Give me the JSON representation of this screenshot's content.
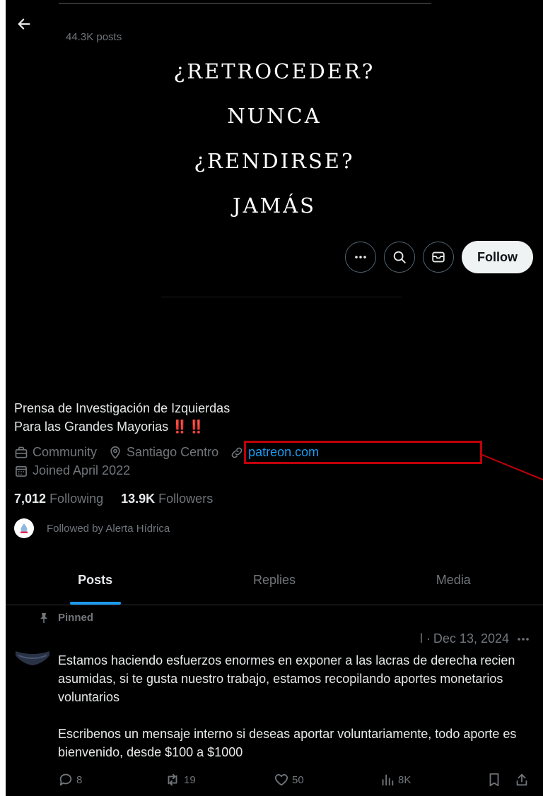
{
  "header": {
    "post_count": "44.3K posts"
  },
  "banner": {
    "lines": [
      "¿RETROCEDER?",
      "NUNCA",
      "¿RENDIRSE?",
      "JAMÁS"
    ]
  },
  "actions": {
    "follow_label": "Follow"
  },
  "profile": {
    "bio_line1": "Prensa de Investigación de Izquierdas",
    "bio_line2": "Para las Grandes Mayorias",
    "bio_emoji": "‼️‼️",
    "category": "Community",
    "location": "Santiago Centro",
    "website": "patreon.com",
    "joined": "Joined April 2022",
    "following_count": "7,012",
    "following_label": "Following",
    "followers_count": "13.9K",
    "followers_label": "Followers",
    "followed_by": "Followed by Alerta Hídrica"
  },
  "tabs": [
    {
      "label": "Posts",
      "active": true
    },
    {
      "label": "Replies",
      "active": false
    },
    {
      "label": "Media",
      "active": false
    }
  ],
  "post": {
    "pinned_label": "Pinned",
    "header_prefix": "l ·",
    "date": "Dec 13, 2024",
    "paragraph1": "Estamos haciendo esfuerzos enormes en exponer a las lacras de derecha recien asumidas, si te gusta nuestro trabajo, estamos recopilando aportes monetarios voluntarios",
    "paragraph2": "Escribenos un mensaje interno si deseas aportar voluntariamente, todo aporte es bienvenido, desde $100 a $1000",
    "replies": "8",
    "reposts": "19",
    "likes": "50",
    "views": "8K"
  },
  "colors": {
    "accent": "#1d9bf0",
    "background": "#000000",
    "highlight_box": "#c0000a"
  }
}
